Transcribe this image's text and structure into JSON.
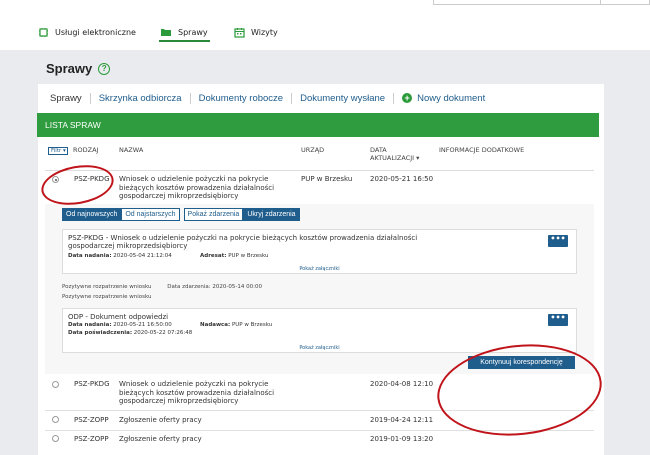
{
  "nav": {
    "items": [
      {
        "label": "Usługi elektroniczne",
        "icon": "services-icon"
      },
      {
        "label": "Sprawy",
        "icon": "folder-icon"
      },
      {
        "label": "Wizyty",
        "icon": "calendar-icon"
      }
    ],
    "active": "Sprawy"
  },
  "page": {
    "title": "Sprawy",
    "help": "?"
  },
  "subnav": {
    "items": [
      "Sprawy",
      "Skrzynka odbiorcza",
      "Dokumenty robocze",
      "Dokumenty wysłane"
    ],
    "new_document": "Nowy dokument",
    "new_document_icon": "+"
  },
  "list": {
    "title": "LISTA SPRAW",
    "filter_label": "Filtr ▾",
    "columns": {
      "type": "RODZAJ",
      "name": "NAZWA",
      "office": "URZĄD",
      "date": "DATA AKTUALIZACJI ▾",
      "info": "INFORMACJE DODATKOWE"
    },
    "rows": [
      {
        "type": "PSZ-PKDG",
        "name": "Wniosek o udzielenie pożyczki na pokrycie bieżących kosztów prowadzenia działalności gospodarczej mikroprzedsiębiorcy",
        "office": "PUP w Brzesku",
        "date": "2020-05-21 16:50"
      },
      {
        "type": "PSZ-PKDG",
        "name": "Wniosek o udzielenie pożyczki na pokrycie bieżących kosztów prowadzenia działalności gospodarczej mikroprzedsiębiorcy",
        "office": "",
        "date": "2020-04-08 12:10"
      },
      {
        "type": "PSZ-ZOPP",
        "name": "Zgłoszenie oferty pracy",
        "office": "",
        "date": "2019-04-24 12:11"
      },
      {
        "type": "PSZ-ZOPP",
        "name": "Zgłoszenie oferty pracy",
        "office": "",
        "date": "2019-01-09 13:20"
      }
    ]
  },
  "details": {
    "tabs": [
      "Od najnowszych",
      "Od najstarszych",
      "Pokaż zdarzenia",
      "Ukryj zdarzenia"
    ],
    "event1": {
      "title": "PSZ-PKDG - Wniosek o udzielenie pożyczki na pokrycie bieżących kosztów prowadzenia działalności gospodarczej mikroprzedsiębiorcy",
      "date_label": "Data nadania:",
      "date": "2020-05-04 21:12:04",
      "addressee_label": "Adresat:",
      "addressee": "PUP w Brzesku",
      "attachments": "Pokaż załączniki",
      "more": "•••"
    },
    "status": {
      "text": "Pozytywne rozpatrzenie wniosku",
      "date_label": "Data zdarzenia:",
      "date": "2020-05-14 00:00",
      "sub": "Pozytywne rozpatrzenie wniosku"
    },
    "event2": {
      "title": "ODP - Dokument odpowiedzi",
      "date_label": "Data nadania:",
      "date": "2020-05-21 16:50:00",
      "sender_label": "Nadawca:",
      "sender": "PUP w Brzesku",
      "confirm_label": "Data poświadczenia:",
      "confirm": "2020-05-22 07:26:48",
      "attachments": "Pokaż załączniki",
      "more": "•••"
    },
    "continue_button": "Kontynuuj korespondencję"
  },
  "colors": {
    "green": "#2f9c3f",
    "blue": "#1f5d8c",
    "annotation": "#c0141b"
  }
}
